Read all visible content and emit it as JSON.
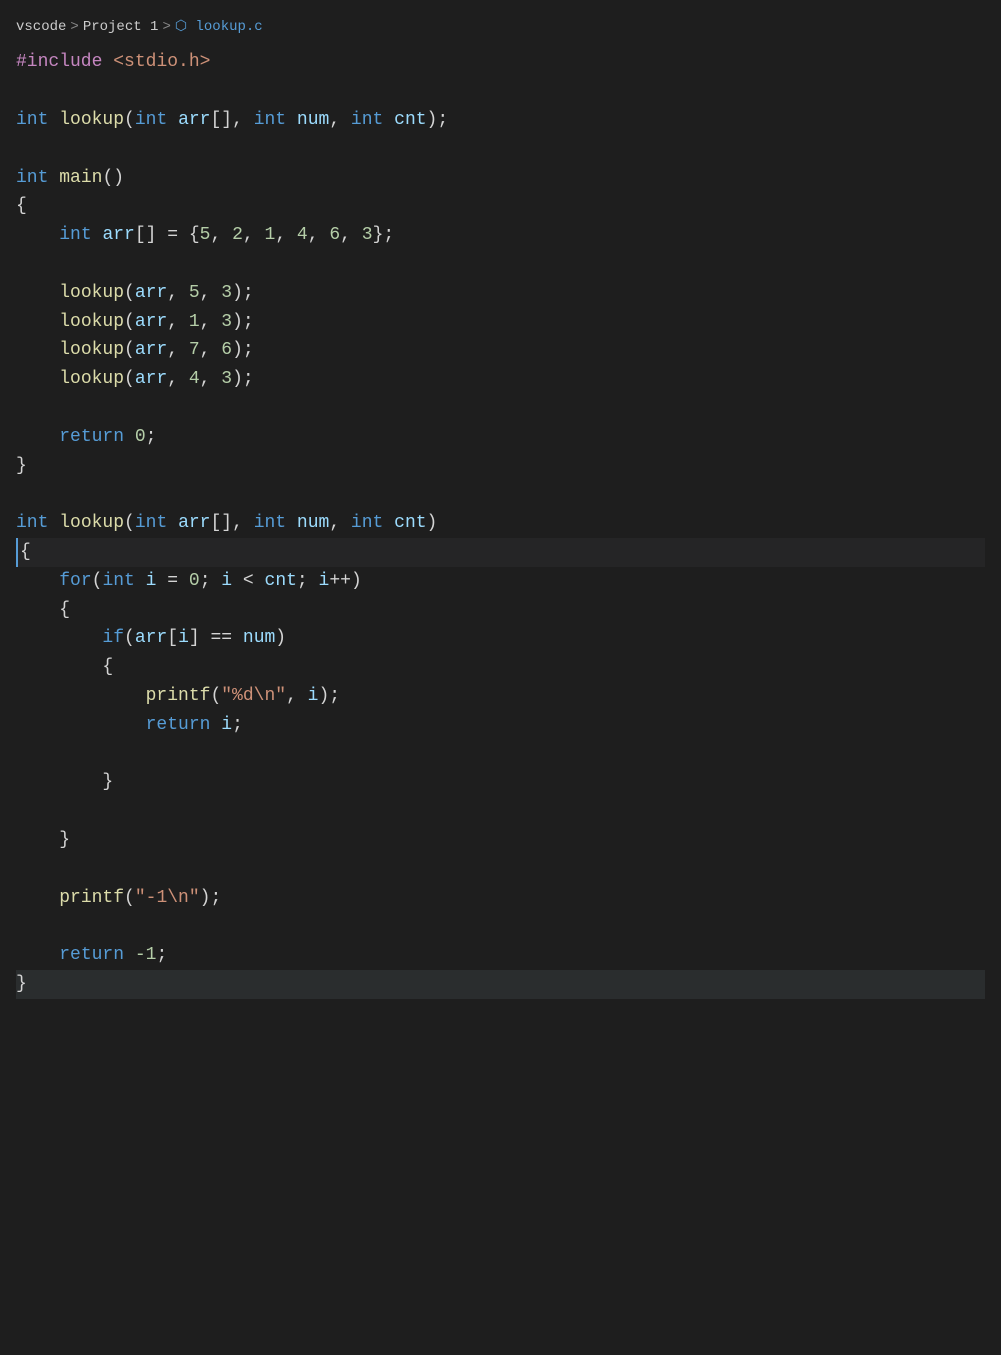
{
  "breadcrumb": {
    "parts": [
      "vscode",
      "Project 1",
      "lookup.c"
    ],
    "icon": "file-icon"
  },
  "code": {
    "lines": [
      {
        "id": 1,
        "tokens": [
          {
            "t": "#include",
            "c": "inc"
          },
          {
            "t": " ",
            "c": "plain"
          },
          {
            "t": "<stdio.h>",
            "c": "inc-path"
          }
        ]
      },
      {
        "id": 2,
        "tokens": []
      },
      {
        "id": 3,
        "tokens": [
          {
            "t": "int",
            "c": "kw"
          },
          {
            "t": " ",
            "c": "plain"
          },
          {
            "t": "lookup",
            "c": "fn"
          },
          {
            "t": "(",
            "c": "punct"
          },
          {
            "t": "int",
            "c": "kw"
          },
          {
            "t": " ",
            "c": "plain"
          },
          {
            "t": "arr",
            "c": "param"
          },
          {
            "t": "[], ",
            "c": "punct"
          },
          {
            "t": "int",
            "c": "kw"
          },
          {
            "t": " ",
            "c": "plain"
          },
          {
            "t": "num",
            "c": "param"
          },
          {
            "t": ", ",
            "c": "punct"
          },
          {
            "t": "int",
            "c": "kw"
          },
          {
            "t": " ",
            "c": "plain"
          },
          {
            "t": "cnt",
            "c": "param"
          },
          {
            "t": ");",
            "c": "punct"
          }
        ]
      },
      {
        "id": 4,
        "tokens": []
      },
      {
        "id": 5,
        "tokens": [
          {
            "t": "int",
            "c": "kw"
          },
          {
            "t": " ",
            "c": "plain"
          },
          {
            "t": "main",
            "c": "fn"
          },
          {
            "t": "()",
            "c": "punct"
          }
        ]
      },
      {
        "id": 6,
        "tokens": [
          {
            "t": "{",
            "c": "punct"
          }
        ]
      },
      {
        "id": 7,
        "tokens": [
          {
            "t": "    ",
            "c": "plain"
          },
          {
            "t": "int",
            "c": "kw"
          },
          {
            "t": " ",
            "c": "plain"
          },
          {
            "t": "arr",
            "c": "param"
          },
          {
            "t": "[] = {",
            "c": "punct"
          },
          {
            "t": "5",
            "c": "num"
          },
          {
            "t": ", ",
            "c": "punct"
          },
          {
            "t": "2",
            "c": "num"
          },
          {
            "t": ", ",
            "c": "punct"
          },
          {
            "t": "1",
            "c": "num"
          },
          {
            "t": ", ",
            "c": "punct"
          },
          {
            "t": "4",
            "c": "num"
          },
          {
            "t": ", ",
            "c": "punct"
          },
          {
            "t": "6",
            "c": "num"
          },
          {
            "t": ", ",
            "c": "punct"
          },
          {
            "t": "3",
            "c": "num"
          },
          {
            "t": "};",
            "c": "punct"
          }
        ]
      },
      {
        "id": 8,
        "tokens": []
      },
      {
        "id": 9,
        "tokens": [
          {
            "t": "    ",
            "c": "plain"
          },
          {
            "t": "lookup",
            "c": "fn"
          },
          {
            "t": "(",
            "c": "punct"
          },
          {
            "t": "arr",
            "c": "param"
          },
          {
            "t": ", ",
            "c": "punct"
          },
          {
            "t": "5",
            "c": "num"
          },
          {
            "t": ", ",
            "c": "punct"
          },
          {
            "t": "3",
            "c": "num"
          },
          {
            "t": ");",
            "c": "punct"
          }
        ]
      },
      {
        "id": 10,
        "tokens": [
          {
            "t": "    ",
            "c": "plain"
          },
          {
            "t": "lookup",
            "c": "fn"
          },
          {
            "t": "(",
            "c": "punct"
          },
          {
            "t": "arr",
            "c": "param"
          },
          {
            "t": ", ",
            "c": "punct"
          },
          {
            "t": "1",
            "c": "num"
          },
          {
            "t": ", ",
            "c": "punct"
          },
          {
            "t": "3",
            "c": "num"
          },
          {
            "t": ");",
            "c": "punct"
          }
        ]
      },
      {
        "id": 11,
        "tokens": [
          {
            "t": "    ",
            "c": "plain"
          },
          {
            "t": "lookup",
            "c": "fn"
          },
          {
            "t": "(",
            "c": "punct"
          },
          {
            "t": "arr",
            "c": "param"
          },
          {
            "t": ", ",
            "c": "punct"
          },
          {
            "t": "7",
            "c": "num"
          },
          {
            "t": ", ",
            "c": "punct"
          },
          {
            "t": "6",
            "c": "num"
          },
          {
            "t": ");",
            "c": "punct"
          }
        ]
      },
      {
        "id": 12,
        "tokens": [
          {
            "t": "    ",
            "c": "plain"
          },
          {
            "t": "lookup",
            "c": "fn"
          },
          {
            "t": "(",
            "c": "punct"
          },
          {
            "t": "arr",
            "c": "param"
          },
          {
            "t": ", ",
            "c": "punct"
          },
          {
            "t": "4",
            "c": "num"
          },
          {
            "t": ", ",
            "c": "punct"
          },
          {
            "t": "3",
            "c": "num"
          },
          {
            "t": ");",
            "c": "punct"
          }
        ]
      },
      {
        "id": 13,
        "tokens": []
      },
      {
        "id": 14,
        "tokens": [
          {
            "t": "    ",
            "c": "plain"
          },
          {
            "t": "return",
            "c": "kw"
          },
          {
            "t": " ",
            "c": "plain"
          },
          {
            "t": "0",
            "c": "num"
          },
          {
            "t": ";",
            "c": "punct"
          }
        ]
      },
      {
        "id": 15,
        "tokens": [
          {
            "t": "}",
            "c": "punct"
          }
        ]
      },
      {
        "id": 16,
        "tokens": []
      },
      {
        "id": 17,
        "tokens": [
          {
            "t": "int",
            "c": "kw"
          },
          {
            "t": " ",
            "c": "plain"
          },
          {
            "t": "lookup",
            "c": "fn"
          },
          {
            "t": "(",
            "c": "punct"
          },
          {
            "t": "int",
            "c": "kw"
          },
          {
            "t": " ",
            "c": "plain"
          },
          {
            "t": "arr",
            "c": "param"
          },
          {
            "t": "[], ",
            "c": "punct"
          },
          {
            "t": "int",
            "c": "kw"
          },
          {
            "t": " ",
            "c": "plain"
          },
          {
            "t": "num",
            "c": "param"
          },
          {
            "t": ", ",
            "c": "punct"
          },
          {
            "t": "int",
            "c": "kw"
          },
          {
            "t": " ",
            "c": "plain"
          },
          {
            "t": "cnt",
            "c": "param"
          },
          {
            "t": ")",
            "c": "punct"
          }
        ]
      },
      {
        "id": 18,
        "tokens": [
          {
            "t": "{",
            "c": "punct"
          }
        ],
        "active": true
      },
      {
        "id": 19,
        "tokens": [
          {
            "t": "    ",
            "c": "plain"
          },
          {
            "t": "for",
            "c": "kw"
          },
          {
            "t": "(",
            "c": "punct"
          },
          {
            "t": "int",
            "c": "kw"
          },
          {
            "t": " ",
            "c": "plain"
          },
          {
            "t": "i",
            "c": "param"
          },
          {
            "t": " = ",
            "c": "punct"
          },
          {
            "t": "0",
            "c": "num"
          },
          {
            "t": "; ",
            "c": "punct"
          },
          {
            "t": "i",
            "c": "param"
          },
          {
            "t": " < ",
            "c": "punct"
          },
          {
            "t": "cnt",
            "c": "param"
          },
          {
            "t": "; ",
            "c": "punct"
          },
          {
            "t": "i",
            "c": "param"
          },
          {
            "t": "++)",
            "c": "punct"
          }
        ]
      },
      {
        "id": 20,
        "tokens": [
          {
            "t": "    {",
            "c": "punct"
          }
        ]
      },
      {
        "id": 21,
        "tokens": [
          {
            "t": "        ",
            "c": "plain"
          },
          {
            "t": "if",
            "c": "kw"
          },
          {
            "t": "(",
            "c": "punct"
          },
          {
            "t": "arr",
            "c": "param"
          },
          {
            "t": "[",
            "c": "punct"
          },
          {
            "t": "i",
            "c": "param"
          },
          {
            "t": "] == ",
            "c": "punct"
          },
          {
            "t": "num",
            "c": "param"
          },
          {
            "t": ")",
            "c": "punct"
          }
        ]
      },
      {
        "id": 22,
        "tokens": [
          {
            "t": "        {",
            "c": "punct"
          }
        ]
      },
      {
        "id": 23,
        "tokens": [
          {
            "t": "            ",
            "c": "plain"
          },
          {
            "t": "printf",
            "c": "fn"
          },
          {
            "t": "(",
            "c": "punct"
          },
          {
            "t": "\"%d\\n\"",
            "c": "str"
          },
          {
            "t": ", ",
            "c": "punct"
          },
          {
            "t": "i",
            "c": "param"
          },
          {
            "t": ");",
            "c": "punct"
          }
        ]
      },
      {
        "id": 24,
        "tokens": [
          {
            "t": "            ",
            "c": "plain"
          },
          {
            "t": "return",
            "c": "kw"
          },
          {
            "t": " ",
            "c": "plain"
          },
          {
            "t": "i",
            "c": "param"
          },
          {
            "t": ";",
            "c": "punct"
          }
        ]
      },
      {
        "id": 25,
        "tokens": []
      },
      {
        "id": 26,
        "tokens": [
          {
            "t": "        }",
            "c": "punct"
          }
        ]
      },
      {
        "id": 27,
        "tokens": []
      },
      {
        "id": 28,
        "tokens": [
          {
            "t": "    }",
            "c": "punct"
          }
        ]
      },
      {
        "id": 29,
        "tokens": []
      },
      {
        "id": 30,
        "tokens": [
          {
            "t": "    ",
            "c": "plain"
          },
          {
            "t": "printf",
            "c": "fn"
          },
          {
            "t": "(",
            "c": "punct"
          },
          {
            "t": "\"-1\\n\"",
            "c": "str"
          },
          {
            "t": ");",
            "c": "punct"
          }
        ]
      },
      {
        "id": 31,
        "tokens": []
      },
      {
        "id": 32,
        "tokens": [
          {
            "t": "    ",
            "c": "plain"
          },
          {
            "t": "return",
            "c": "kw"
          },
          {
            "t": " ",
            "c": "plain"
          },
          {
            "t": "-1",
            "c": "num"
          },
          {
            "t": ";",
            "c": "punct"
          }
        ]
      },
      {
        "id": 33,
        "tokens": [
          {
            "t": "}",
            "c": "punct"
          }
        ],
        "last": true
      }
    ]
  }
}
